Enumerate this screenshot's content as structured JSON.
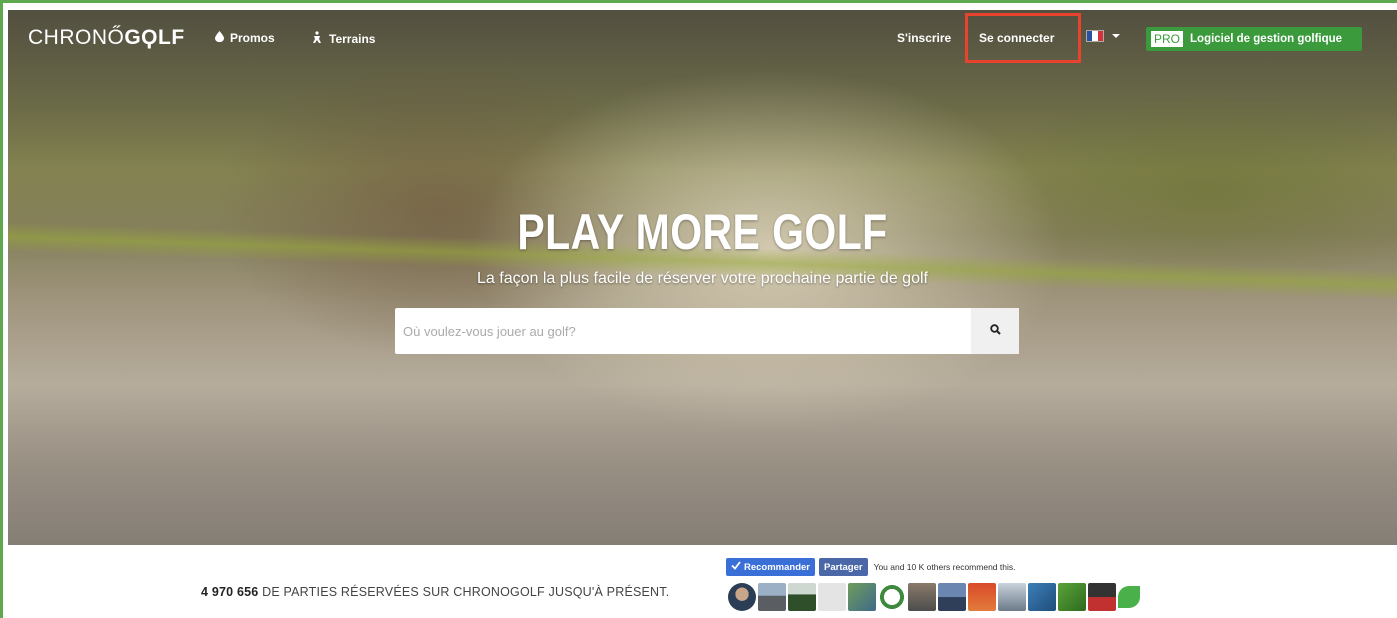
{
  "nav": {
    "logo_light": "CHRONŐ",
    "logo_bold": "GϘLF",
    "promos": "Promos",
    "terrains": "Terrains",
    "signup": "S'inscrire",
    "login": "Se connecter",
    "pro_badge": "PRO",
    "pro_label": "Logiciel de gestion golfique"
  },
  "hero": {
    "title": "PLAY MORE GOLF",
    "subtitle": "La façon la plus facile de réserver votre prochaine partie de golf",
    "search_placeholder": "Où voulez-vous jouer au golf?"
  },
  "stats": {
    "count": "4 970 656",
    "text": " DE PARTIES RÉSERVÉES SUR CHRONOGOLF JUSQU'À PRÉSENT."
  },
  "facebook": {
    "recommend": "Recommander",
    "share": "Partager",
    "social_text": "You and 10 K others recommend this."
  },
  "colors": {
    "accent_green": "#3a9a3c",
    "highlight_red": "#e8432f",
    "fb_blue": "#3b6fd8"
  }
}
